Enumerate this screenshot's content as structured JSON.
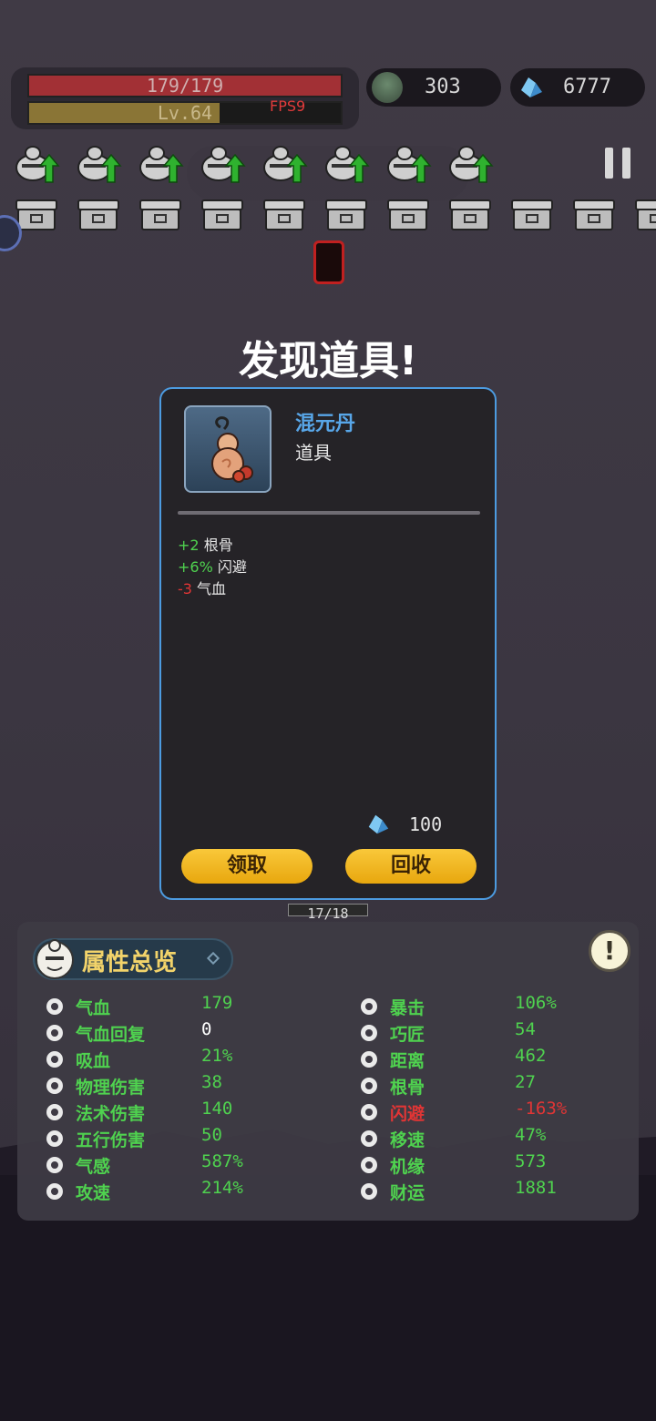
{
  "hud": {
    "hp_text": "179/179",
    "hp_fraction": 1.0,
    "level_text": "Lv.64",
    "level_fraction": 0.61,
    "fps": "FPS9",
    "gold": "303",
    "gems": "6777"
  },
  "wave_icons": {
    "ghost_count": 8,
    "chest_count": 11
  },
  "modal": {
    "title": "发现道具!",
    "item_name": "混元丹",
    "item_type": "道具",
    "stats": [
      {
        "num": "+2",
        "label": "根骨",
        "positive": true
      },
      {
        "num": "+6%",
        "label": "闪避",
        "positive": true
      },
      {
        "num": "-3",
        "label": "气血",
        "positive": false
      }
    ],
    "cost": "100",
    "claim_label": "领取",
    "recycle_label": "回收"
  },
  "player_hp": "17/18",
  "panel": {
    "title": "属性总览",
    "left": [
      {
        "icon": "heart-icon",
        "label": "气血",
        "value": "179"
      },
      {
        "icon": "heart-regen-icon",
        "label": "气血回复",
        "value": "0",
        "value_color": "white"
      },
      {
        "icon": "blood-drop-icon",
        "label": "吸血",
        "value": "21%"
      },
      {
        "icon": "sword-icon",
        "label": "物理伤害",
        "value": "38"
      },
      {
        "icon": "spiral-icon",
        "label": "法术伤害",
        "value": "140"
      },
      {
        "icon": "rings-icon",
        "label": "五行伤害",
        "value": "50"
      },
      {
        "icon": "sense-icon",
        "label": "气感",
        "value": "587%"
      },
      {
        "icon": "speed-swirl-icon",
        "label": "攻速",
        "value": "214%"
      }
    ],
    "right": [
      {
        "icon": "crit-icon",
        "label": "暴击",
        "value": "106%"
      },
      {
        "icon": "hammer-icon",
        "label": "巧匠",
        "value": "54"
      },
      {
        "icon": "target-icon",
        "label": "距离",
        "value": "462"
      },
      {
        "icon": "meditate-icon",
        "label": "根骨",
        "value": "27"
      },
      {
        "icon": "dodge-icon",
        "label": "闪避",
        "value": "-163%",
        "red": true
      },
      {
        "icon": "boot-icon",
        "label": "移速",
        "value": "47%"
      },
      {
        "icon": "fortune-icon",
        "label": "机缘",
        "value": "573"
      },
      {
        "icon": "coin-icon",
        "label": "财运",
        "value": "1881"
      }
    ]
  }
}
